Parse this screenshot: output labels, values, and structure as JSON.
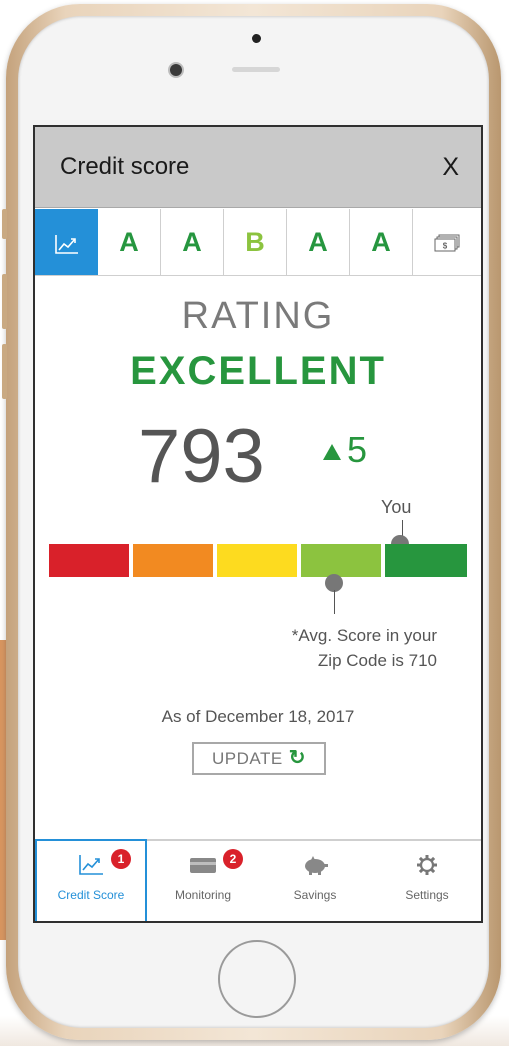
{
  "header": {
    "title": "Credit score",
    "close_label": "X"
  },
  "tabs": [
    {
      "type": "icon",
      "icon": "chart-icon",
      "active": true
    },
    {
      "grade": "A"
    },
    {
      "grade": "A"
    },
    {
      "grade": "B"
    },
    {
      "grade": "A"
    },
    {
      "grade": "A"
    },
    {
      "type": "icon",
      "icon": "money-icon"
    }
  ],
  "rating": {
    "label": "RATING",
    "value": "EXCELLENT"
  },
  "score": {
    "value": "793",
    "change": "5"
  },
  "meter": {
    "you_label": "You",
    "segments": [
      "#d9212a",
      "#f28a21",
      "#fddb1f",
      "#8cc33f",
      "#27963e"
    ],
    "avg_note_line1": "*Avg. Score in your",
    "avg_note_line2": "Zip Code is 710"
  },
  "as_of": "As of December 18, 2017",
  "update_button": {
    "label": "UPDATE",
    "icon": "refresh-icon"
  },
  "nav": [
    {
      "label": "Credit Score",
      "icon": "chart-icon",
      "badge": "1",
      "active": true
    },
    {
      "label": "Monitoring",
      "icon": "card-icon",
      "badge": "2"
    },
    {
      "label": "Savings",
      "icon": "piggy-bank-icon"
    },
    {
      "label": "Settings",
      "icon": "gear-icon"
    }
  ],
  "colors": {
    "accent_blue": "#2490d8",
    "green": "#27963e",
    "badge_red": "#d9212a"
  }
}
